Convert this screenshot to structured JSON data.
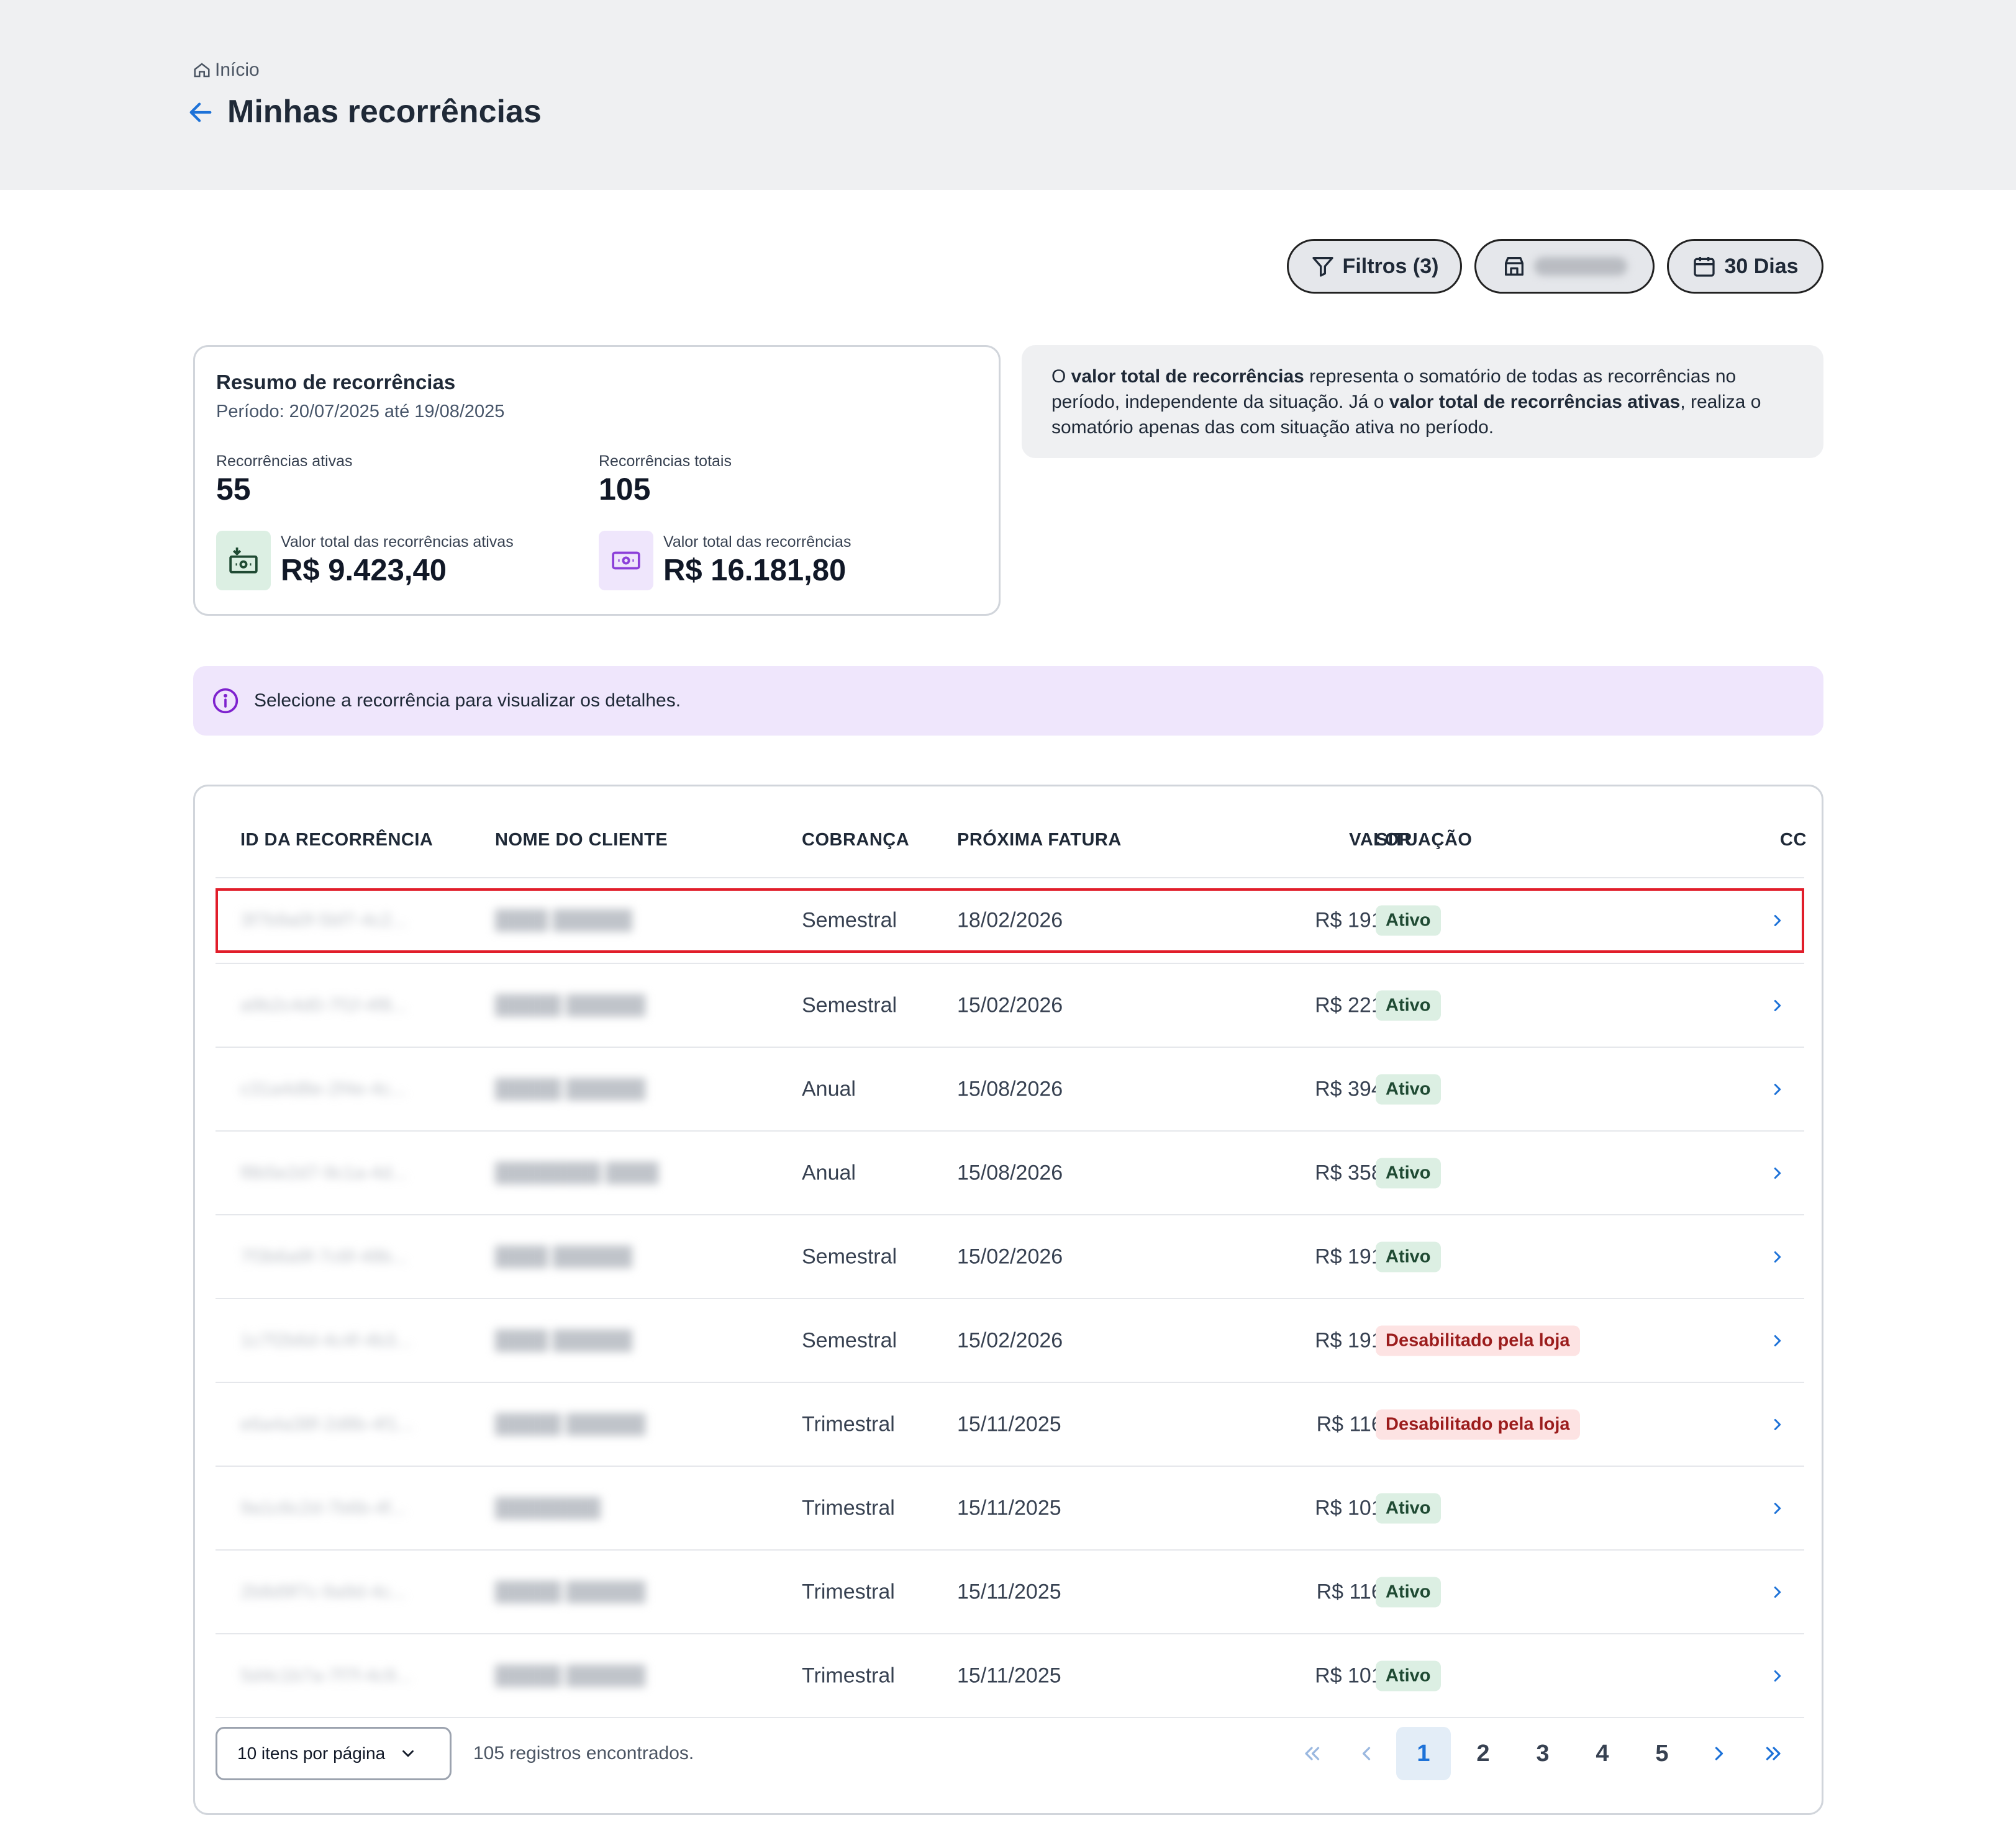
{
  "breadcrumb": {
    "home_label": "Início"
  },
  "page": {
    "title": "Minhas recorrências"
  },
  "toolbar": {
    "filters_label": "Filtros (3)",
    "period_label": "30 Dias"
  },
  "summary": {
    "title": "Resumo de recorrências",
    "period": "Período: 20/07/2025 até 19/08/2025",
    "active_label": "Recorrências ativas",
    "active_count": "55",
    "total_label": "Recorrências totais",
    "total_count": "105",
    "active_value_label": "Valor total das recorrências ativas",
    "active_value": "R$ 9.423,40",
    "total_value_label": "Valor total das recorrências",
    "total_value": "R$ 16.181,80"
  },
  "note": {
    "p1": "O ",
    "b1": "valor total de recorrências",
    "p2": " representa o somatório de todas as recorrências no período, independente da situação. Já o ",
    "b2": "valor total de recorrências ativas",
    "p3": ", realiza o somatório apenas das com situação ativa no período."
  },
  "info": {
    "text": "Selecione a recorrência para visualizar os detalhes."
  },
  "table": {
    "headers": [
      "ID DA RECORRÊNCIA",
      "NOME DO CLIENTE",
      "COBRANÇA",
      "PRÓXIMA FATURA",
      "VALOR",
      "SITUAÇÃO",
      "CC"
    ],
    "rows": [
      {
        "id": "3f7b9a0f-5bf7-4c2...",
        "name": "████ ██████",
        "billing": "Semestral",
        "next": "18/02/2026",
        "value": "R$ 191,40",
        "status": "Ativo"
      },
      {
        "id": "a9b2c4d0-7f1f-4f8...",
        "name": "█████ ██████",
        "billing": "Semestral",
        "next": "15/02/2026",
        "value": "R$ 221,40",
        "status": "Ativo"
      },
      {
        "id": "c31a4d8e-2f4e-4c...",
        "name": "█████ ██████",
        "billing": "Anual",
        "next": "15/08/2026",
        "value": "R$ 394,80",
        "status": "Ativo"
      },
      {
        "id": "f8b5e2d7-9c1a-4d...",
        "name": "████████ ████",
        "billing": "Anual",
        "next": "15/08/2026",
        "value": "R$ 358,80",
        "status": "Ativo"
      },
      {
        "id": "7f3b6a9f-7c6f-48b...",
        "name": "████ ██████",
        "billing": "Semestral",
        "next": "15/02/2026",
        "value": "R$ 191,40",
        "status": "Ativo"
      },
      {
        "id": "1c7f2b6d-4c4f-4b3...",
        "name": "████ ██████",
        "billing": "Semestral",
        "next": "15/02/2026",
        "value": "R$ 191,40",
        "status": "Desabilitado pela loja"
      },
      {
        "id": "e6a4a38f-2d8b-4f1...",
        "name": "█████ ██████",
        "billing": "Trimestral",
        "next": "15/11/2025",
        "value": "R$ 116,70",
        "status": "Desabilitado pela loja"
      },
      {
        "id": "9a1c6c2d-7b6b-4f...",
        "name": "████████",
        "billing": "Trimestral",
        "next": "15/11/2025",
        "value": "R$ 101,70",
        "status": "Ativo"
      },
      {
        "id": "2b8d9f7c-9a9d-4c...",
        "name": "█████ ██████",
        "billing": "Trimestral",
        "next": "15/11/2025",
        "value": "R$ 116,70",
        "status": "Ativo"
      },
      {
        "id": "5d4c1b7a-7f7f-4c9...",
        "name": "█████ ██████",
        "billing": "Trimestral",
        "next": "15/11/2025",
        "value": "R$ 101,70",
        "status": "Ativo"
      }
    ]
  },
  "pagination": {
    "per_page_label": "10 itens por página",
    "records_label": "105 registros encontrados.",
    "pages": [
      "1",
      "2",
      "3",
      "4",
      "5"
    ],
    "current_page": "1"
  },
  "colors": {
    "active_badge_bg": "#dcefe3",
    "active_badge_text": "#1f4a33",
    "disabled_badge_bg": "#fde3e3",
    "disabled_badge_text": "#9b1c1c",
    "accent_blue": "#1d72d8",
    "selection_outline": "#e11d2a",
    "info_bg": "#efe6fc"
  },
  "icons": [
    "home-icon",
    "arrow-left-icon",
    "filter-icon",
    "store-icon",
    "calendar-icon",
    "money-in-icon",
    "money-icon",
    "info-icon",
    "chevron-right-icon",
    "chevron-down-icon",
    "double-chevron-left-icon",
    "chevron-left-icon",
    "double-chevron-right-icon"
  ]
}
